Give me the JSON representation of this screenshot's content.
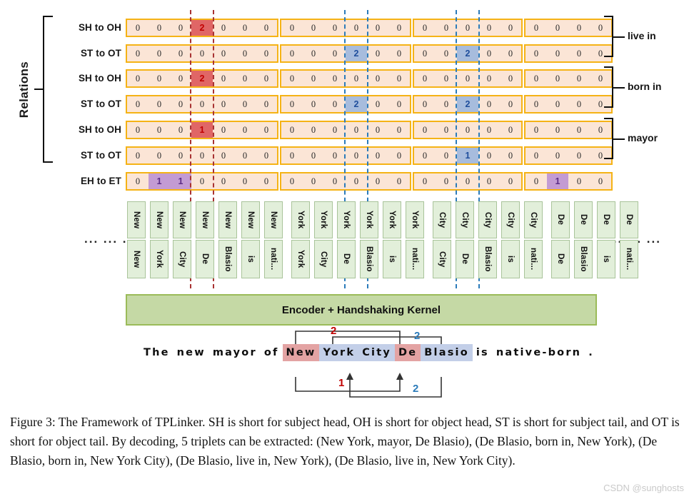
{
  "figure": {
    "relations_label": "Relations",
    "row_labels": [
      "SH to OH",
      "ST to OT",
      "SH to OH",
      "ST to OT",
      "SH to OH",
      "ST to OT",
      "EH to ET"
    ],
    "relation_names": [
      "live in",
      "born in",
      "mayor"
    ],
    "encoder_label": "Encoder + Handshaking Kernel",
    "ellipsis_left": "... ... ...",
    "ellipsis_right": "... ... ...",
    "group_sizes": [
      7,
      6,
      5,
      4
    ],
    "token_pairs": [
      {
        "top": "New",
        "bottom": "New"
      },
      {
        "top": "New",
        "bottom": "York"
      },
      {
        "top": "New",
        "bottom": "City"
      },
      {
        "top": "New",
        "bottom": "De"
      },
      {
        "top": "New",
        "bottom": "Blasio"
      },
      {
        "top": "New",
        "bottom": "is"
      },
      {
        "top": "New",
        "bottom": "nati..."
      },
      {
        "top": "York",
        "bottom": "York"
      },
      {
        "top": "York",
        "bottom": "City"
      },
      {
        "top": "York",
        "bottom": "De"
      },
      {
        "top": "York",
        "bottom": "Blasio"
      },
      {
        "top": "York",
        "bottom": "is"
      },
      {
        "top": "York",
        "bottom": "nati..."
      },
      {
        "top": "City",
        "bottom": "City"
      },
      {
        "top": "City",
        "bottom": "De"
      },
      {
        "top": "City",
        "bottom": "Blasio"
      },
      {
        "top": "City",
        "bottom": "is"
      },
      {
        "top": "City",
        "bottom": "nati..."
      },
      {
        "top": "De",
        "bottom": "De"
      },
      {
        "top": "De",
        "bottom": "Blasio"
      },
      {
        "top": "De",
        "bottom": "is"
      },
      {
        "top": "De",
        "bottom": "nati..."
      }
    ],
    "matrix_rows": [
      {
        "label": "SH to OH",
        "values": [
          0,
          0,
          0,
          2,
          0,
          0,
          0,
          0,
          0,
          0,
          0,
          0,
          0,
          0,
          0,
          0,
          0,
          0,
          0,
          0,
          0,
          0
        ],
        "highlights": {
          "3": "red"
        }
      },
      {
        "label": "ST to OT",
        "values": [
          0,
          0,
          0,
          0,
          0,
          0,
          0,
          0,
          0,
          0,
          2,
          0,
          0,
          0,
          0,
          2,
          0,
          0,
          0,
          0,
          0,
          0
        ],
        "highlights": {
          "10": "blue",
          "15": "blue"
        }
      },
      {
        "label": "SH to OH",
        "values": [
          0,
          0,
          0,
          2,
          0,
          0,
          0,
          0,
          0,
          0,
          0,
          0,
          0,
          0,
          0,
          0,
          0,
          0,
          0,
          0,
          0,
          0
        ],
        "highlights": {
          "3": "red"
        }
      },
      {
        "label": "ST to OT",
        "values": [
          0,
          0,
          0,
          0,
          0,
          0,
          0,
          0,
          0,
          0,
          2,
          0,
          0,
          0,
          0,
          2,
          0,
          0,
          0,
          0,
          0,
          0
        ],
        "highlights": {
          "10": "blue",
          "15": "blue"
        }
      },
      {
        "label": "SH to OH",
        "values": [
          0,
          0,
          0,
          1,
          0,
          0,
          0,
          0,
          0,
          0,
          0,
          0,
          0,
          0,
          0,
          0,
          0,
          0,
          0,
          0,
          0,
          0
        ],
        "highlights": {
          "3": "red"
        }
      },
      {
        "label": "ST to OT",
        "values": [
          0,
          0,
          0,
          0,
          0,
          0,
          0,
          0,
          0,
          0,
          0,
          0,
          0,
          0,
          0,
          1,
          0,
          0,
          0,
          0,
          0,
          0
        ],
        "highlights": {
          "15": "blue"
        }
      },
      {
        "label": "EH to ET",
        "values": [
          0,
          1,
          1,
          0,
          0,
          0,
          0,
          0,
          0,
          0,
          0,
          0,
          0,
          0,
          0,
          0,
          0,
          0,
          0,
          1,
          0,
          0
        ],
        "highlights": {
          "1": "purple",
          "2": "purple",
          "19": "purple"
        }
      }
    ],
    "sentence": [
      {
        "text": "The",
        "style": "plain"
      },
      {
        "text": "new",
        "style": "plain"
      },
      {
        "text": "mayor",
        "style": "plain"
      },
      {
        "text": "of",
        "style": "plain"
      },
      {
        "text": "New",
        "style": "red"
      },
      {
        "text": "York",
        "style": "blue"
      },
      {
        "text": "City",
        "style": "blue"
      },
      {
        "text": "De",
        "style": "red"
      },
      {
        "text": "Blasio",
        "style": "blue"
      },
      {
        "text": "is",
        "style": "plain"
      },
      {
        "text": "native-born",
        "style": "plain"
      },
      {
        "text": ".",
        "style": "plain"
      }
    ],
    "arrow_labels": [
      {
        "id": "arrow-label-top-2-red",
        "text": "2",
        "color": "#c00000"
      },
      {
        "id": "arrow-label-top-2-blue",
        "text": "2",
        "color": "#2b7bba"
      },
      {
        "id": "arrow-label-bottom-1-red",
        "text": "1",
        "color": "#c00000"
      },
      {
        "id": "arrow-label-bottom-2-blue",
        "text": "2",
        "color": "#2b7bba"
      }
    ],
    "colors": {
      "cell_fill": "#fbe5d6",
      "cell_border": "#f5b316",
      "highlight_red": "#e06666",
      "highlight_blue": "#a7bcdd",
      "highlight_purple": "#c39bd3",
      "token_fill": "#e2efda",
      "token_border": "#a9c49a",
      "encoder_fill": "#c5d9a5",
      "encoder_border": "#9bbb59",
      "guide_red": "#a83232",
      "guide_blue": "#2b7bba"
    }
  },
  "caption": {
    "text": "Figure 3: The Framework of TPLinker. SH is short for subject head, OH is short for object head, ST is short for subject tail, and OT is short for object tail. By decoding, 5 triplets can be extracted: (New York, mayor, De Blasio), (De Blasio, born in, New York), (De Blasio, born in, New York City), (De Blasio, live in, New York), (De Blasio, live in, New York City)."
  },
  "watermark": {
    "text": "CSDN @sunghosts"
  }
}
